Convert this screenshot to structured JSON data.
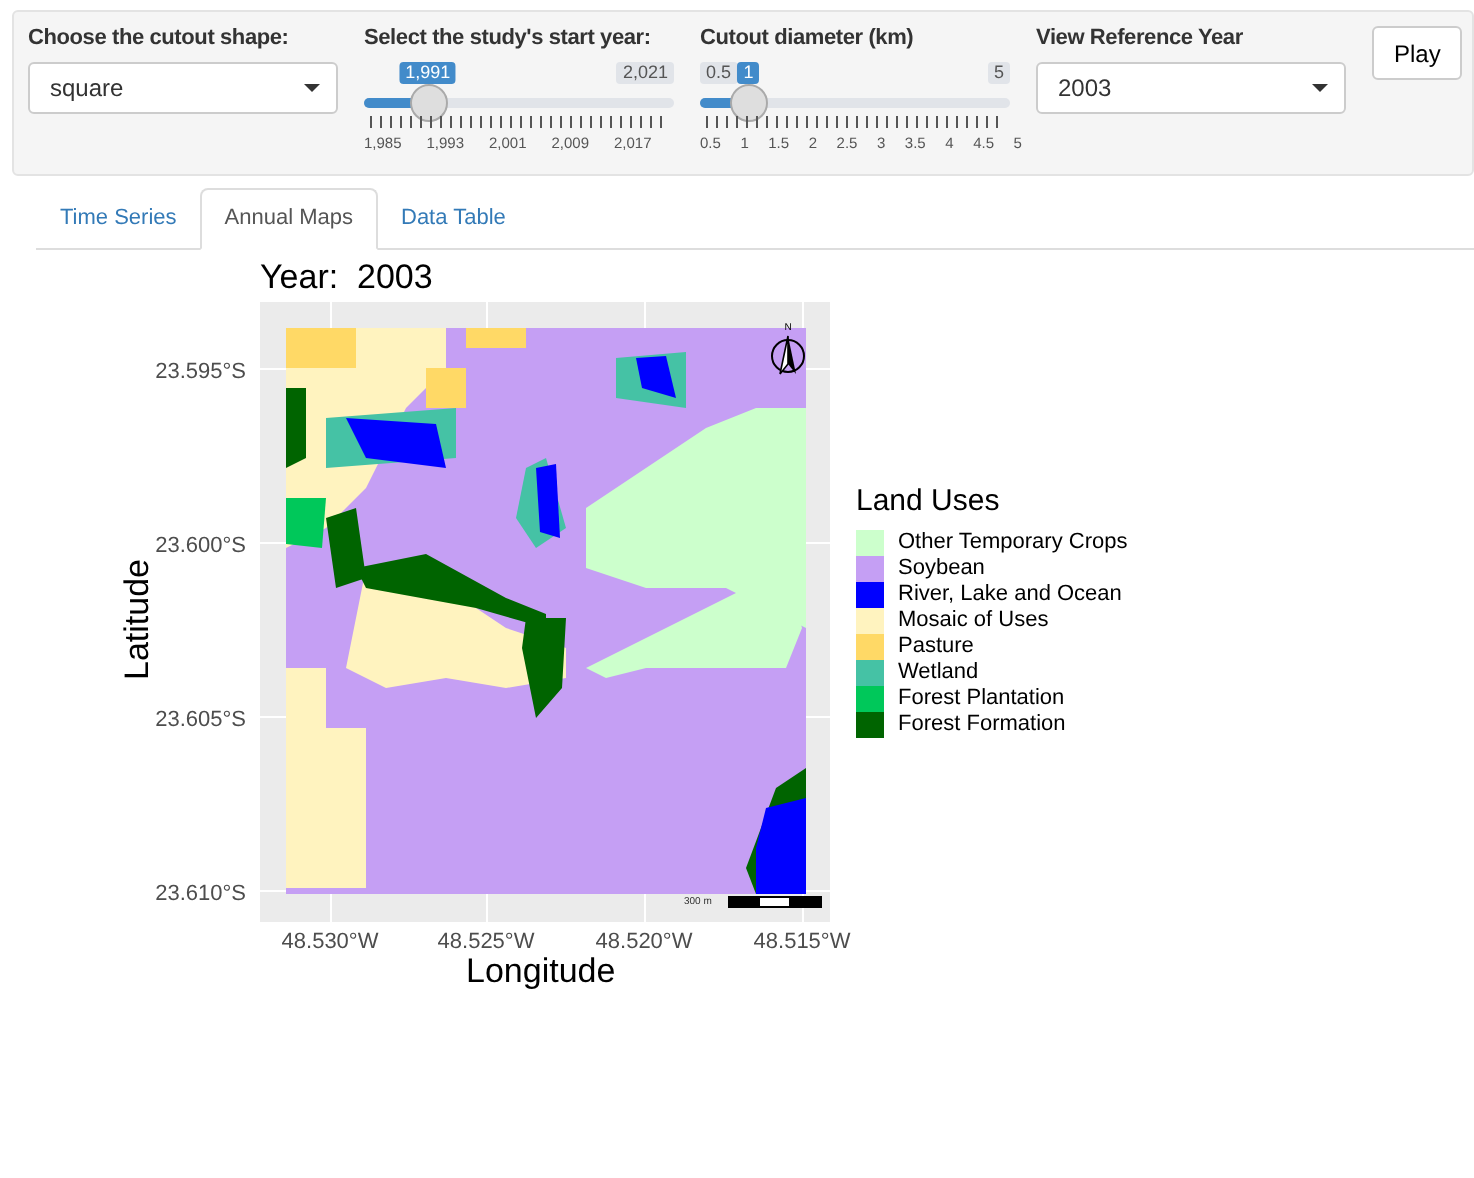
{
  "controls": [
    {
      "kind": "select",
      "label": "Choose the cutout shape:",
      "value": "square"
    },
    {
      "kind": "slider",
      "label": "Select the study's start year:",
      "max": "2,021",
      "value": "1,991",
      "level": 0.167,
      "ticks": [
        "1,985",
        "1,993",
        "2,001",
        "2,009",
        "2,017"
      ]
    },
    {
      "kind": "slider",
      "label": "Cutout diameter (km)",
      "min": "0.5",
      "max": "5",
      "value": "1",
      "level": 0.111,
      "ticks": [
        "0.5",
        "1",
        "1.5",
        "2",
        "2.5",
        "3",
        "3.5",
        "4",
        "4.5",
        "5"
      ]
    },
    {
      "kind": "select",
      "label": "View Reference Year",
      "value": "2003"
    }
  ],
  "play_button": "Play",
  "tabs": [
    {
      "label": "Time Series",
      "selected": false
    },
    {
      "label": "Annual Maps",
      "selected": true
    },
    {
      "label": "Data Table",
      "selected": false
    }
  ],
  "map": {
    "title": "Year:  2003",
    "ylabel": "Latitude",
    "xlabel": "Longitude",
    "yticks": [
      "23.595°S",
      "23.600°S",
      "23.605°S",
      "23.610°S"
    ],
    "xticks": [
      "48.530°W",
      "48.525°W",
      "48.520°W",
      "48.515°W"
    ],
    "north_label": "N",
    "scale_label": "300 m",
    "legend": {
      "title": "Land Uses",
      "items": [
        {
          "label": "Other Temporary Crops",
          "color": "#ccffcc"
        },
        {
          "label": "Soybean",
          "color": "#c59ff4"
        },
        {
          "label": "River, Lake and Ocean",
          "color": "#0000ff"
        },
        {
          "label": "Mosaic of Uses",
          "color": "#fff3bf"
        },
        {
          "label": "Pasture",
          "color": "#ffd966"
        },
        {
          "label": "Wetland",
          "color": "#45c2a5"
        },
        {
          "label": "Forest Plantation",
          "color": "#00c85a"
        },
        {
          "label": "Forest Formation",
          "color": "#006400"
        }
      ]
    }
  }
}
